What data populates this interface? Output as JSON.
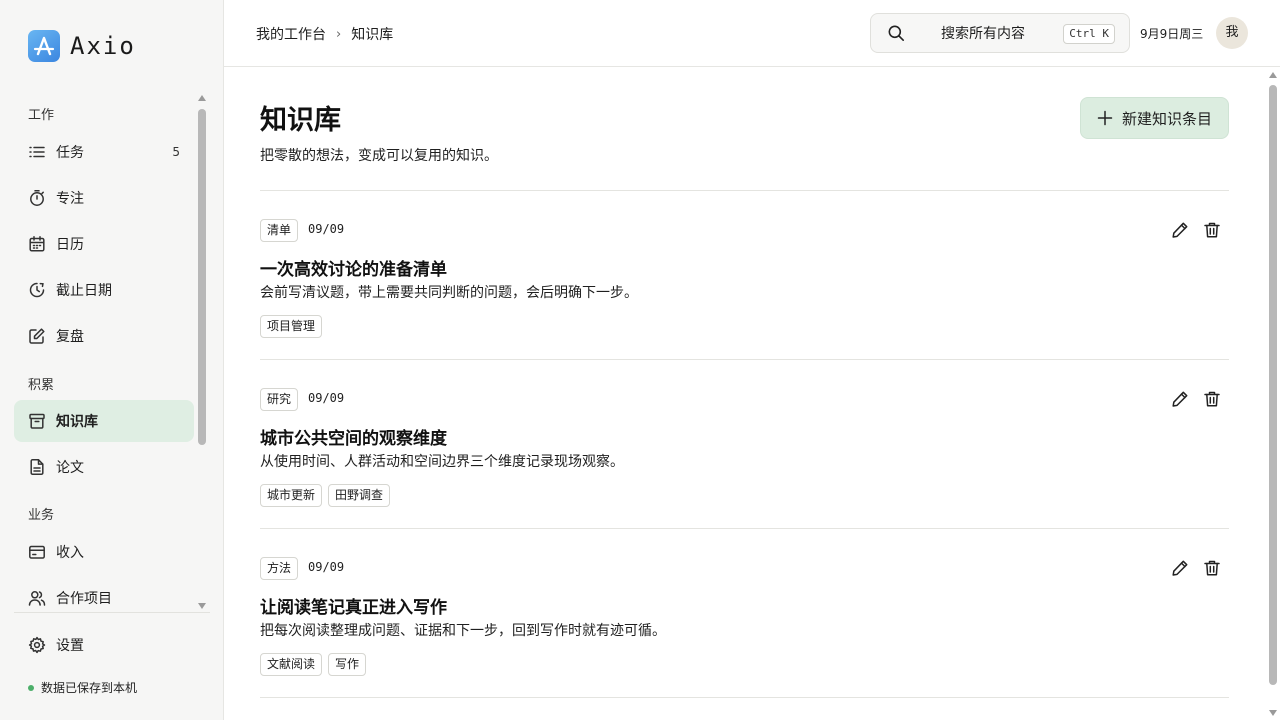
{
  "app": {
    "name": "Axio"
  },
  "colors": {
    "accent": "#dfeee3",
    "logo": "#4a97e8",
    "saved_dot": "#4caf6a"
  },
  "sidebar": {
    "sections": [
      {
        "label": "工作"
      },
      {
        "label": "积累"
      },
      {
        "label": "业务"
      }
    ],
    "items": [
      {
        "label": "任务",
        "icon": "list-icon",
        "badge": "5"
      },
      {
        "label": "专注",
        "icon": "timer-icon"
      },
      {
        "label": "日历",
        "icon": "calendar-icon"
      },
      {
        "label": "截止日期",
        "icon": "deadline-clock-icon"
      },
      {
        "label": "复盘",
        "icon": "edit-square-icon"
      },
      {
        "label": "知识库",
        "icon": "archive-icon",
        "active": true
      },
      {
        "label": "论文",
        "icon": "document-icon"
      },
      {
        "label": "收入",
        "icon": "wallet-icon"
      },
      {
        "label": "合作项目",
        "icon": "users-icon"
      }
    ],
    "settings_label": "设置",
    "saved_note": "数据已保存到本机"
  },
  "header": {
    "breadcrumb": [
      "我的工作台",
      "知识库"
    ],
    "breadcrumb_sep": "›",
    "search_placeholder": "搜索所有内容",
    "search_shortcut": "Ctrl K",
    "date": "9月9日周三",
    "avatar_text": "我"
  },
  "main": {
    "title": "知识库",
    "subtitle": "把零散的想法，变成可以复用的知识。",
    "new_button_label": "新建知识条目",
    "entries": [
      {
        "category": "清单",
        "date": "09/09",
        "title": "一次高效讨论的准备清单",
        "description": "会前写清议题，带上需要共同判断的问题，会后明确下一步。",
        "tags": [
          "项目管理"
        ]
      },
      {
        "category": "研究",
        "date": "09/09",
        "title": "城市公共空间的观察维度",
        "description": "从使用时间、人群活动和空间边界三个维度记录现场观察。",
        "tags": [
          "城市更新",
          "田野调查"
        ]
      },
      {
        "category": "方法",
        "date": "09/09",
        "title": "让阅读笔记真正进入写作",
        "description": "把每次阅读整理成问题、证据和下一步，回到写作时就有迹可循。",
        "tags": [
          "文献阅读",
          "写作"
        ]
      }
    ]
  }
}
